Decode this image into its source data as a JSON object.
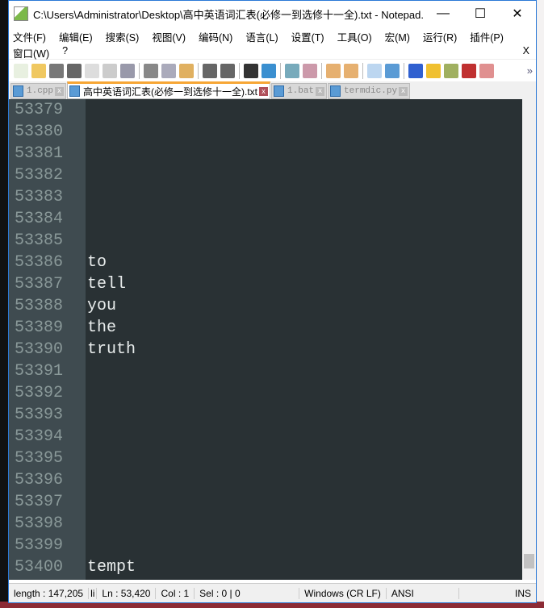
{
  "window": {
    "title": "C:\\Users\\Administrator\\Desktop\\高中英语词汇表(必修一到选修十一全).txt - Notepad...",
    "minimize": "—",
    "maximize": "☐",
    "close": "✕"
  },
  "menu": [
    "文件(F)",
    "编辑(E)",
    "搜索(S)",
    "视图(V)",
    "编码(N)",
    "语言(L)",
    "设置(T)",
    "工具(O)",
    "宏(M)",
    "运行(R)",
    "插件(P)",
    "窗口(W)",
    "?"
  ],
  "menu_close": "X",
  "toolbar_overflow": "»",
  "tabs": [
    {
      "label": "1.cpp",
      "active": false
    },
    {
      "label": "高中英语词汇表(必修一到选修十一全).txt",
      "active": true
    },
    {
      "label": "1.bat",
      "active": false
    },
    {
      "label": "termdic.py",
      "active": false
    }
  ],
  "lines": [
    {
      "n": "53379",
      "t": ""
    },
    {
      "n": "53380",
      "t": ""
    },
    {
      "n": "53381",
      "t": ""
    },
    {
      "n": "53382",
      "t": ""
    },
    {
      "n": "53383",
      "t": ""
    },
    {
      "n": "53384",
      "t": ""
    },
    {
      "n": "53385",
      "t": ""
    },
    {
      "n": "53386",
      "t": "to"
    },
    {
      "n": "53387",
      "t": "tell"
    },
    {
      "n": "53388",
      "t": "you"
    },
    {
      "n": "53389",
      "t": "the"
    },
    {
      "n": "53390",
      "t": "truth"
    },
    {
      "n": "53391",
      "t": ""
    },
    {
      "n": "53392",
      "t": ""
    },
    {
      "n": "53393",
      "t": ""
    },
    {
      "n": "53394",
      "t": ""
    },
    {
      "n": "53395",
      "t": ""
    },
    {
      "n": "53396",
      "t": ""
    },
    {
      "n": "53397",
      "t": ""
    },
    {
      "n": "53398",
      "t": ""
    },
    {
      "n": "53399",
      "t": ""
    },
    {
      "n": "53400",
      "t": "tempt"
    }
  ],
  "status": {
    "length": "length : 147,205",
    "li": "li",
    "ln": "Ln : 53,420",
    "col": "Col : 1",
    "sel": "Sel : 0 | 0",
    "eol": "Windows (CR LF)",
    "enc": "ANSI",
    "mode": "INS"
  },
  "colors": {
    "editor_bg": "#293134",
    "gutter_bg": "#3f4b50",
    "active_tab_accent": "#f7a635"
  }
}
